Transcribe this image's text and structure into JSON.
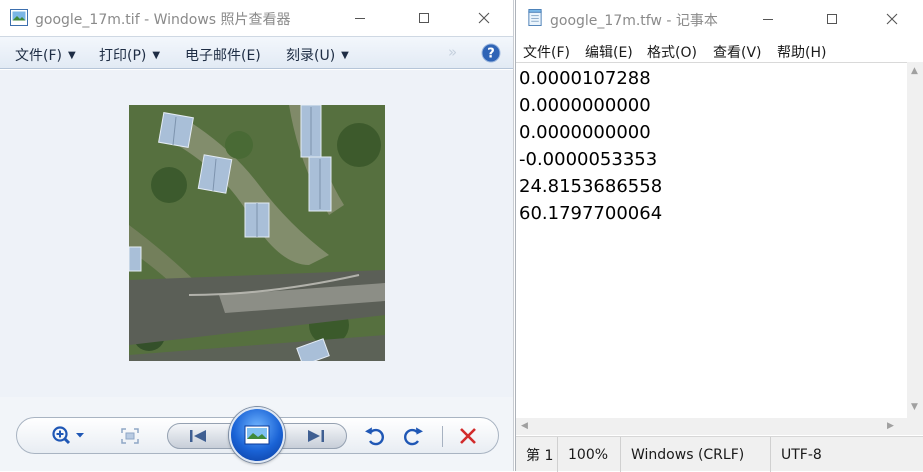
{
  "photo_viewer": {
    "title": "google_17m.tif - Windows 照片查看器",
    "menus": [
      {
        "label": "文件(F)"
      },
      {
        "label": "打印(P)"
      },
      {
        "label": "电子邮件(E)"
      },
      {
        "label": "刻录(U)"
      }
    ],
    "icons": {
      "app": "photo-viewer-icon",
      "more": "double-chevron-icon",
      "help": "help-icon",
      "zoom": "magnifier-icon",
      "actual_size": "fit-window-icon",
      "prev": "previous-icon",
      "slideshow": "slideshow-icon",
      "next": "next-icon",
      "rotate_ccw": "rotate-ccw-icon",
      "rotate_cw": "rotate-cw-icon",
      "delete": "delete-icon"
    },
    "colors": {
      "accent": "#1a63d6",
      "delete": "#d22b2b",
      "canvas": "#eef2f8"
    }
  },
  "notepad": {
    "title": "google_17m.tfw - 记事本",
    "menus": [
      {
        "label": "文件(F)"
      },
      {
        "label": "编辑(E)"
      },
      {
        "label": "格式(O)"
      },
      {
        "label": "查看(V)"
      },
      {
        "label": "帮助(H)"
      }
    ],
    "lines": [
      "0.0000107288",
      "0.0000000000",
      "0.0000000000",
      "-0.0000053353",
      "24.8153686558",
      "60.1797700064"
    ],
    "status": {
      "position": "第 1",
      "zoom": "100%",
      "line_ending": "Windows (CRLF)",
      "encoding": "UTF-8"
    }
  }
}
